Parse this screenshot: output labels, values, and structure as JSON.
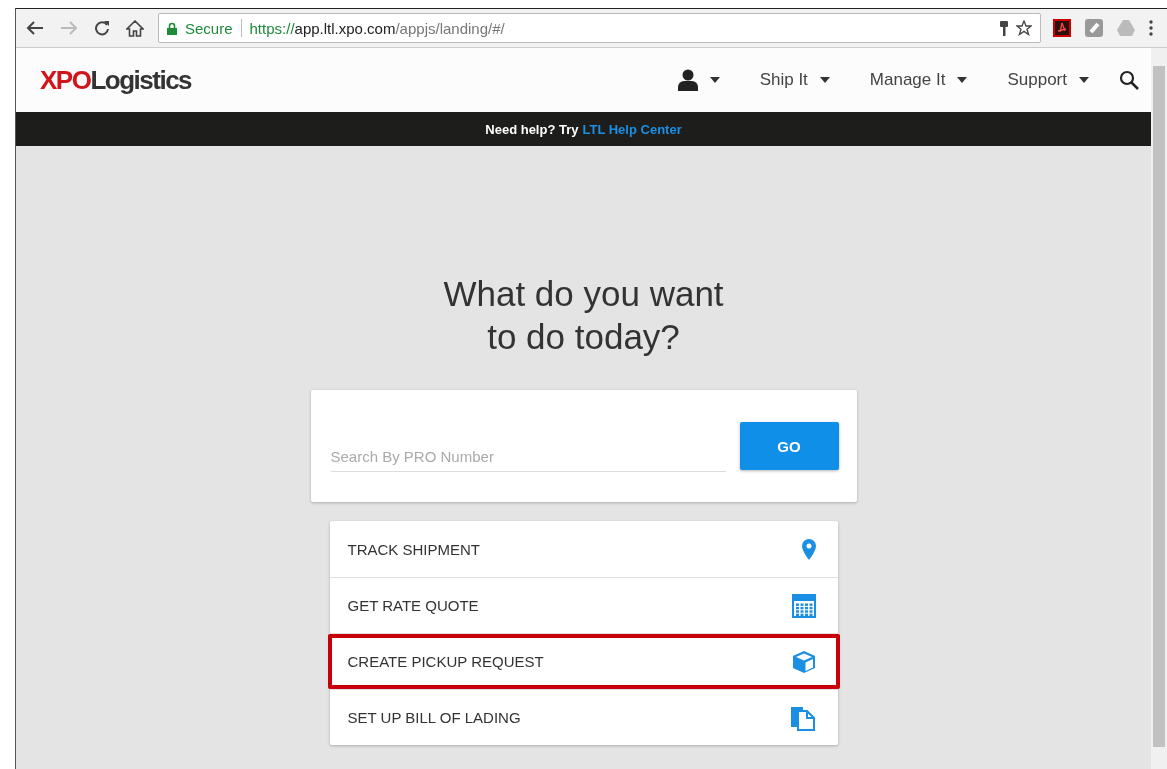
{
  "browser": {
    "security_label": "Secure",
    "url": [
      {
        "kind": "scheme",
        "text": "https://"
      },
      {
        "kind": "host",
        "text": "app.ltl.xpo.com"
      },
      {
        "kind": "path",
        "text": "/appjs/landing/#/"
      }
    ]
  },
  "header": {
    "logo": {
      "brand": "XPO",
      "word": "Logistics"
    },
    "nav": [
      {
        "kind": "user"
      },
      {
        "kind": "menu",
        "label": "Ship It"
      },
      {
        "kind": "menu",
        "label": "Manage It"
      },
      {
        "kind": "menu",
        "label": "Support"
      }
    ]
  },
  "help_bar": {
    "text": "Need help? Try",
    "link": "LTL Help Center"
  },
  "headline": [
    "What do you want",
    "to do today?"
  ],
  "search": {
    "placeholder": "Search By PRO Number",
    "button": "GO"
  },
  "actions": [
    {
      "label": "TRACK SHIPMENT",
      "kind": "pin",
      "highlighted": false
    },
    {
      "label": "GET RATE QUOTE",
      "kind": "calculator",
      "highlighted": false
    },
    {
      "label": "CREATE PICKUP REQUEST",
      "kind": "box",
      "highlighted": true
    },
    {
      "label": "SET UP BILL OF LADING",
      "kind": "documents",
      "highlighted": false
    }
  ]
}
